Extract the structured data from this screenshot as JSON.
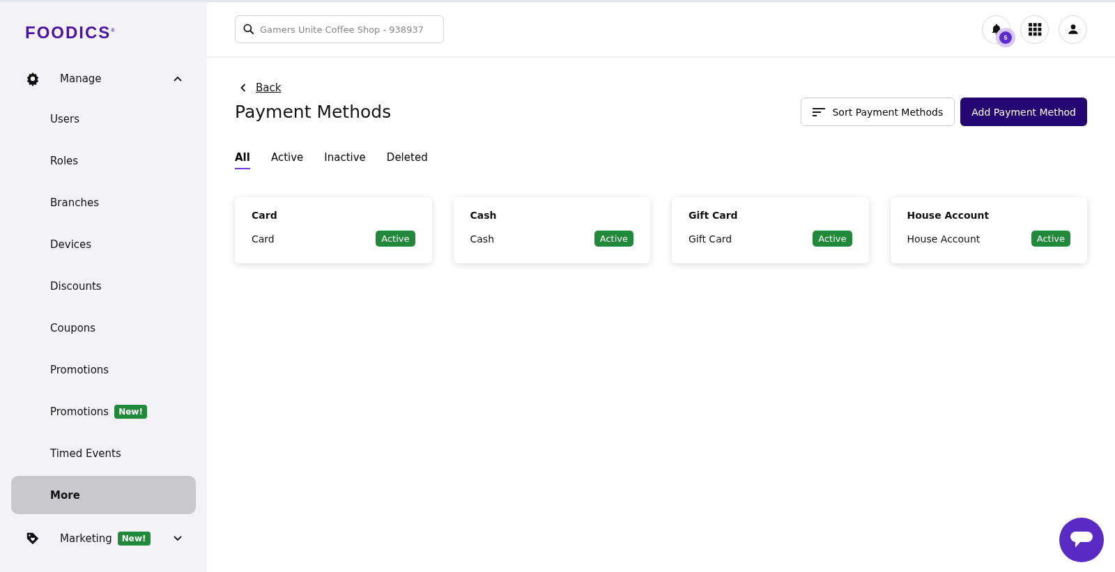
{
  "logo": {
    "text": "FOODICS",
    "mark": "®"
  },
  "sidebar": {
    "groups": [
      {
        "label": "Manage",
        "kind": "settings",
        "expanded": true,
        "children": [
          {
            "label": "Users",
            "selected": false
          },
          {
            "label": "Roles",
            "selected": false
          },
          {
            "label": "Branches",
            "selected": false
          },
          {
            "label": "Devices",
            "selected": false
          },
          {
            "label": "Discounts",
            "selected": false
          },
          {
            "label": "Coupons",
            "selected": false
          },
          {
            "label": "Promotions",
            "selected": false
          },
          {
            "label": "Promotions",
            "badge": "New!",
            "selected": false
          },
          {
            "label": "Timed Events",
            "selected": false
          },
          {
            "label": "More",
            "selected": true
          }
        ]
      },
      {
        "label": "Marketing",
        "kind": "marketing",
        "expanded": false,
        "badge": "New!"
      }
    ]
  },
  "topbar": {
    "search": {
      "placeholder": "Gamers Unite Coffee Shop - 938937"
    },
    "notification_count": "5"
  },
  "back_link": "Back",
  "title": "Payment Methods",
  "buttons": {
    "sort": "Sort Payment Methods",
    "add": "Add Payment Method"
  },
  "tabs": [
    {
      "label": "All",
      "selected": true
    },
    {
      "label": "Active",
      "selected": false
    },
    {
      "label": "Inactive",
      "selected": false
    },
    {
      "label": "Deleted",
      "selected": false
    }
  ],
  "cards": [
    {
      "title": "Card",
      "type": "Card",
      "status": "Active",
      "active": true
    },
    {
      "title": "Cash",
      "type": "Cash",
      "status": "Active",
      "active": true
    },
    {
      "title": "Gift Card",
      "type": "Gift Card",
      "status": "Active",
      "active": true
    },
    {
      "title": "House Account",
      "type": "House Account",
      "status": "Active",
      "active": true
    }
  ]
}
